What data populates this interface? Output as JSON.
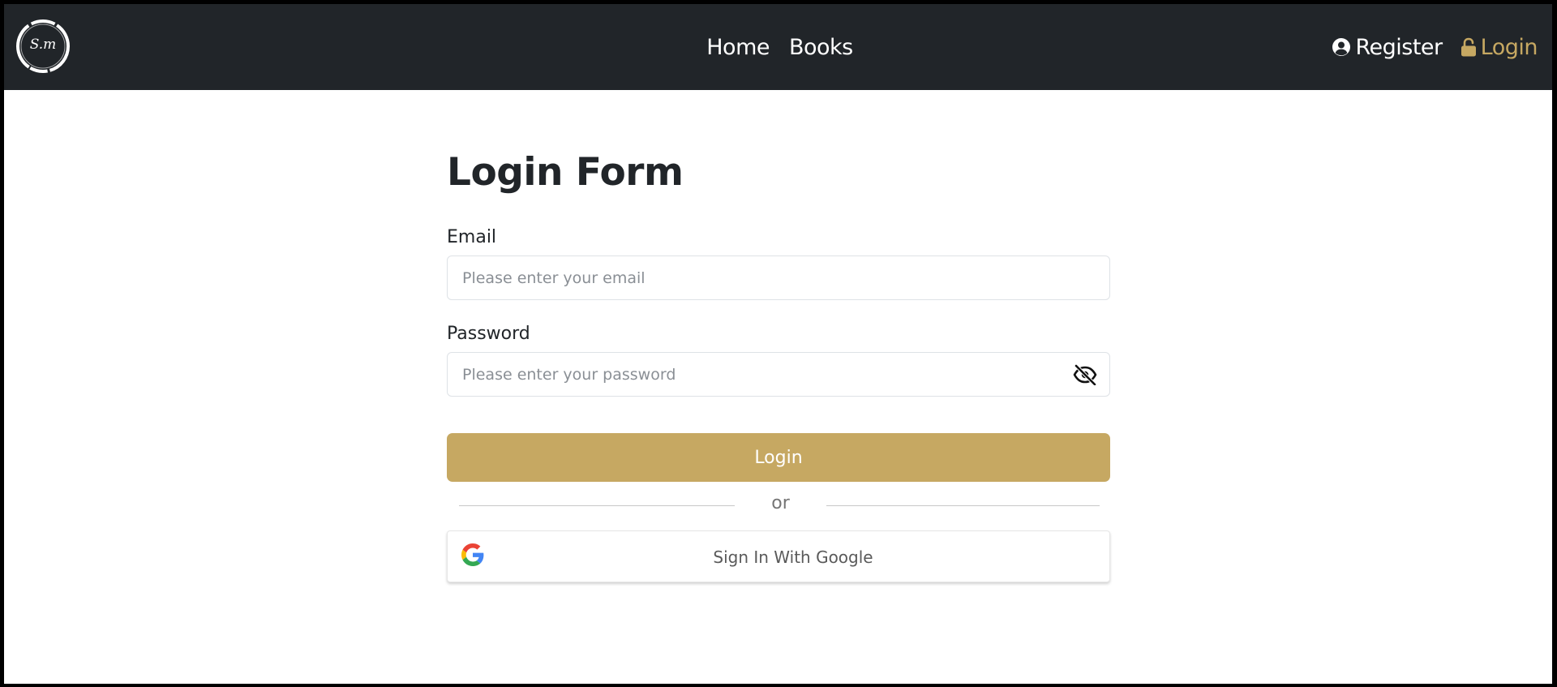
{
  "navbar": {
    "logo_text": "S.m",
    "links": [
      "Home",
      "Books"
    ],
    "register_label": "Register",
    "login_label": "Login",
    "background": "#212529",
    "accent": "#c6a862",
    "icons": {
      "register": "user-circle-icon",
      "login": "unlock-icon"
    }
  },
  "form": {
    "title": "Login Form",
    "email_label": "Email",
    "email_placeholder": "Please enter your email",
    "email_value": "",
    "password_label": "Password",
    "password_placeholder": "Please enter your password",
    "password_value": "",
    "password_toggle_icon": "eye-slash-icon",
    "submit_label": "Login",
    "submit_color": "#c6a862",
    "divider_text": "or",
    "google_label": "Sign In With Google",
    "google_icon": "google-icon"
  }
}
